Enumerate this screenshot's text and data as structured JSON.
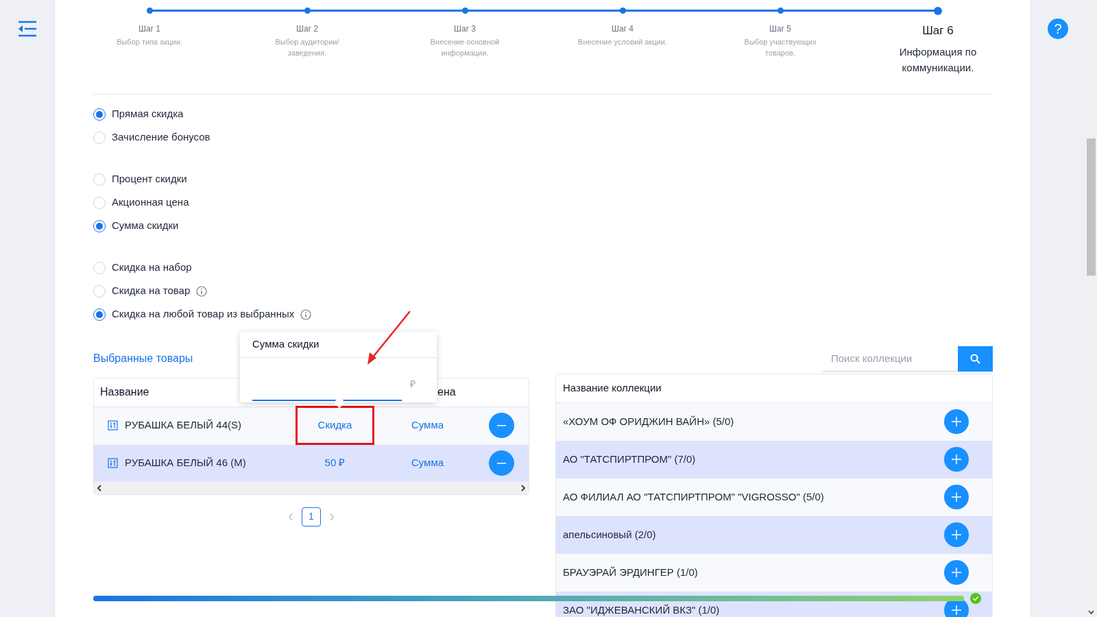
{
  "steps": [
    {
      "title": "Шаг 1",
      "description": "Выбор типа акции.",
      "selected": false
    },
    {
      "title": "Шаг 2",
      "description": "Выбор аудитории/заведения.",
      "selected": false
    },
    {
      "title": "Шаг 3",
      "description": "Внесение основной информации.",
      "selected": false
    },
    {
      "title": "Шаг 4",
      "description": "Внесение условий акции.",
      "selected": false
    },
    {
      "title": "Шаг 5",
      "description": "Выбор участвующих товаров.",
      "selected": false
    },
    {
      "title": "Шаг 6",
      "description": "Информация по коммуникации.",
      "selected": true
    }
  ],
  "radio_groups": [
    [
      {
        "label": "Прямая скидка",
        "selected": true,
        "info": false
      },
      {
        "label": "Зачисление бонусов",
        "selected": false,
        "info": false
      }
    ],
    [
      {
        "label": "Процент скидки",
        "selected": false,
        "info": false
      },
      {
        "label": "Акционная цена",
        "selected": false,
        "info": false
      },
      {
        "label": "Сумма скидки",
        "selected": true,
        "info": false
      }
    ],
    [
      {
        "label": "Скидка на набор",
        "selected": false,
        "info": false
      },
      {
        "label": "Скидка на товар",
        "selected": false,
        "info": true
      },
      {
        "label": "Скидка на любой товар из выбранных",
        "selected": true,
        "info": true
      }
    ]
  ],
  "selected_products": {
    "title": "Выбранные товары",
    "columns": [
      "Название",
      "ена"
    ],
    "rows": [
      {
        "name": "РУБАШКА БЕЛЫЙ 44(S)",
        "discount": "Скидка",
        "price": "Сумма",
        "highlighted": true
      },
      {
        "name": "РУБАШКА БЕЛЫЙ 46 (M)",
        "discount": "50 ₽",
        "price": "Сумма",
        "highlighted": false
      }
    ],
    "pages": [
      {
        "label": "1",
        "selected": true
      }
    ]
  },
  "popover": {
    "title": "Сумма скидки",
    "suffix": "₽"
  },
  "collections": {
    "search_placeholder": "Поиск коллекции",
    "column": "Название коллекции",
    "rows": [
      "«ХОУМ ОФ ОРИДЖИН ВАЙН» (5/0)",
      "АО \"ТАТСПИРТПРОМ\" (7/0)",
      "АО ФИЛИАЛ АО \"ТАТСПИРТПРОМ\" \"VIGROSSO\" (5/0)",
      "апельсиновый (2/0)",
      "БРАУЭРАЙ ЭРДИНГЕР (1/0)",
      "ЗАО \"ИДЖЕВАНСКИЙ ВКЗ\" (1/0)"
    ]
  },
  "progress": {
    "level": 1
  },
  "help_button": {
    "label": "?"
  }
}
